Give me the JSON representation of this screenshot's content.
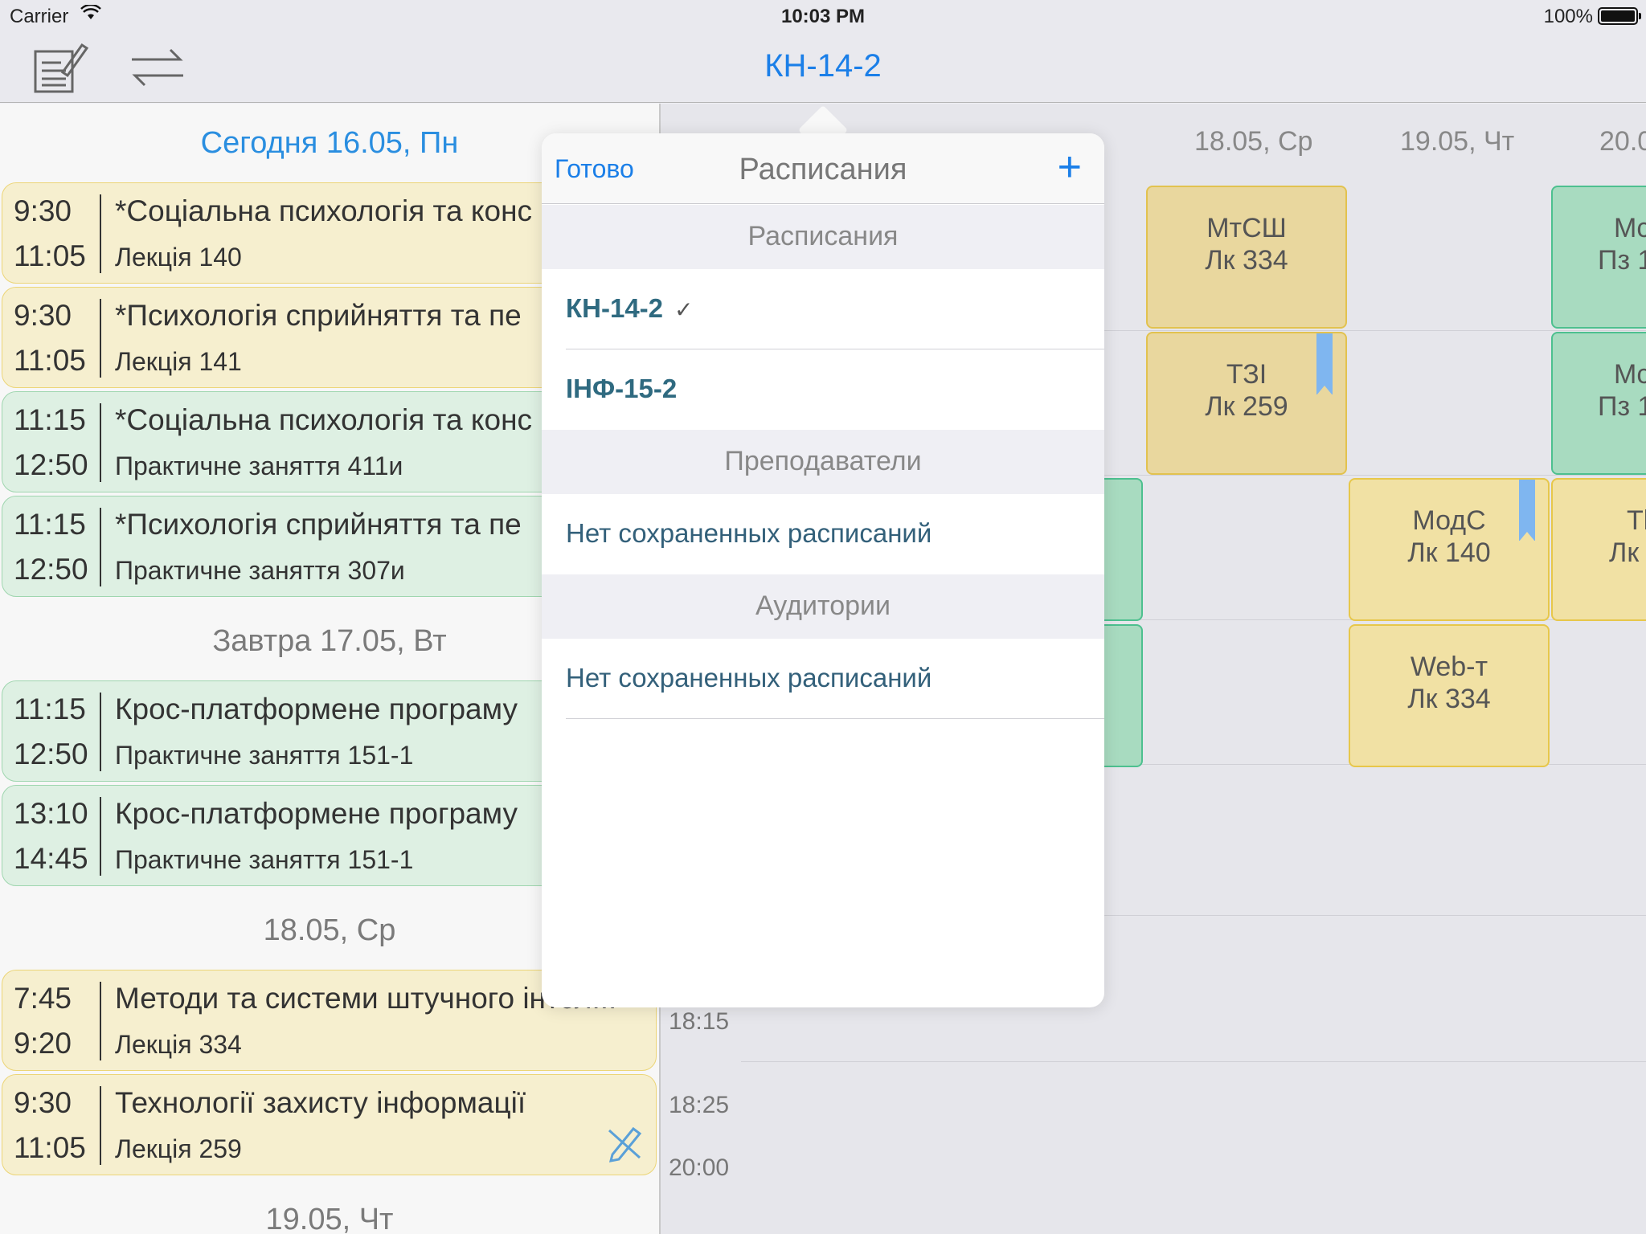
{
  "status_bar": {
    "carrier": "Carrier",
    "time": "10:03 PM",
    "battery": "100%"
  },
  "nav": {
    "title": "КН-14-2",
    "left_icons": [
      "notes-icon",
      "swap-icon"
    ]
  },
  "left_list": {
    "days": [
      {
        "header": "Сегодня 16.05, Пн",
        "today": true
      },
      {
        "header": "Завтра 17.05, Вт"
      },
      {
        "header": "18.05, Ср"
      },
      {
        "header": "19.05, Чт"
      }
    ],
    "lessons": [
      {
        "start": "9:30",
        "end": "11:05",
        "title": "*Соціальна психологія та конс",
        "sub": "Лекція 140",
        "color": "yellow"
      },
      {
        "start": "9:30",
        "end": "11:05",
        "title": "*Психологія сприйняття та пе",
        "sub": "Лекція 141",
        "color": "yellow"
      },
      {
        "start": "11:15",
        "end": "12:50",
        "title": "*Соціальна психологія та конс",
        "sub": "Практичне заняття 411и",
        "color": "green"
      },
      {
        "start": "11:15",
        "end": "12:50",
        "title": "*Психологія сприйняття та пе",
        "sub": "Практичне заняття 307и",
        "color": "green"
      },
      {
        "start": "11:15",
        "end": "12:50",
        "title": "Крос-платформене програму",
        "sub": "Практичне заняття 151-1",
        "color": "green"
      },
      {
        "start": "13:10",
        "end": "14:45",
        "title": "Крос-платформене програму",
        "sub": "Практичне заняття 151-1",
        "color": "green"
      },
      {
        "start": "7:45",
        "end": "9:20",
        "title": "Методи та системи штучного інтел...",
        "sub": "Лекція 334",
        "color": "yellow"
      },
      {
        "start": "9:30",
        "end": "11:05",
        "title": "Технології захисту інформації",
        "sub": "Лекція 259",
        "color": "yellow"
      }
    ]
  },
  "timetable": {
    "col_headers": [
      ".",
      "18.05, Ср",
      "19.05, Чт",
      "20.0"
    ],
    "time_labels": [
      "18:15",
      "18:25",
      "20:00"
    ],
    "cells": [
      {
        "name": "МтСШ",
        "room": "Лк 334"
      },
      {
        "name": "ТЗІ",
        "room": "Лк 259"
      },
      {
        "name": "МодС",
        "room": "Лк 140"
      },
      {
        "name": "Web-т",
        "room": "Лк 334"
      },
      {
        "name": "Mc",
        "room": "Пз 1"
      },
      {
        "name": "Mc",
        "room": "Пз 1"
      },
      {
        "name": "Tl",
        "room": "Лк"
      }
    ]
  },
  "popover": {
    "done": "Готово",
    "title": "Расписания",
    "plus": "+",
    "sections": [
      {
        "header": "Расписания",
        "rows": [
          "КН-14-2",
          "ІНФ-15-2"
        ],
        "checked": "✓"
      },
      {
        "header": "Преподаватели",
        "rows": [
          "Нет сохраненных расписаний"
        ]
      },
      {
        "header": "Аудитории",
        "rows": [
          "Нет сохраненных расписаний"
        ]
      }
    ]
  },
  "colors": {
    "accent": "#1b7fe8",
    "yellow": "#f1e1a4",
    "green": "#a8dbc0",
    "ribbon": "#7fb6f0"
  }
}
